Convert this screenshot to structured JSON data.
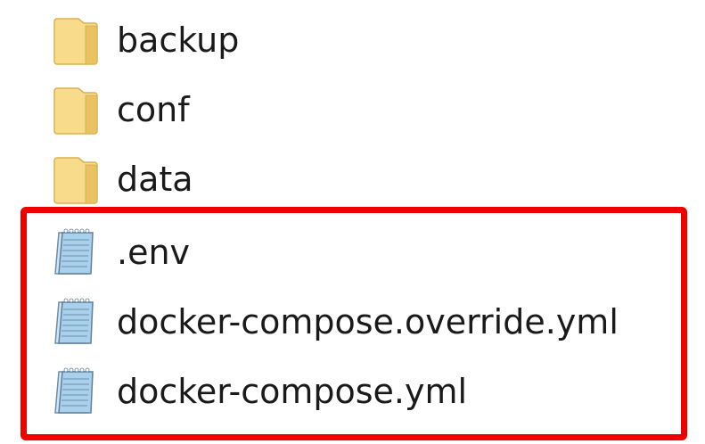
{
  "explorer": {
    "items": [
      {
        "name": "backup",
        "icon": "folder-icon",
        "type": "folder"
      },
      {
        "name": "conf",
        "icon": "folder-icon",
        "type": "folder"
      },
      {
        "name": "data",
        "icon": "folder-icon",
        "type": "folder"
      },
      {
        "name": ".env",
        "icon": "text-file-icon",
        "type": "file"
      },
      {
        "name": "docker-compose.override.yml",
        "icon": "text-file-icon",
        "type": "file"
      },
      {
        "name": "docker-compose.yml",
        "icon": "text-file-icon",
        "type": "file"
      }
    ]
  },
  "colors": {
    "highlight": "#ee0000",
    "folder": "#f6d47a",
    "text_file": "#8fc4e6"
  }
}
